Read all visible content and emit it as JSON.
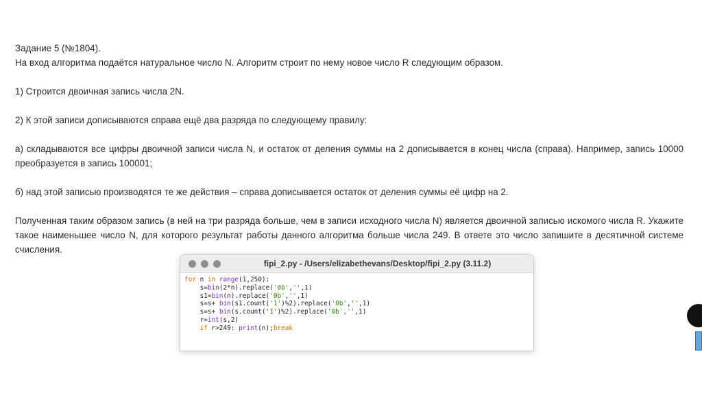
{
  "task": {
    "title": "Задание 5 (№1804).",
    "intro": "На вход алгоритма подаётся натуральное число N. Алгоритм строит по нему новое число R следующим образом.",
    "step1": "1) Строится двоичная запись числа 2N.",
    "step2": "2) К этой записи дописываются справа ещё два разряда по следующему правилу:",
    "step2a": "а) складываются все цифры двоичной записи числа N, и остаток от деления суммы на 2 дописывается в конец числа (справа). Например, запись 10000 преобразуется в запись 100001;",
    "step2b": "б) над этой записью производятся те же действия – справа дописывается остаток от деления суммы её цифр на 2.",
    "conclusion": "Полученная таким образом запись (в ней на три разряда больше, чем в записи исходного числа N) является двоичной записью искомого числа R. Укажите такое наименьшее число N, для которого результат работы данного алгоритма больше числа 249. В ответе это число запишите в десятичной системе счисления."
  },
  "code_window": {
    "title": "fipi_2.py - /Users/elizabethevans/Desktop/fipi_2.py (3.11.2)"
  }
}
